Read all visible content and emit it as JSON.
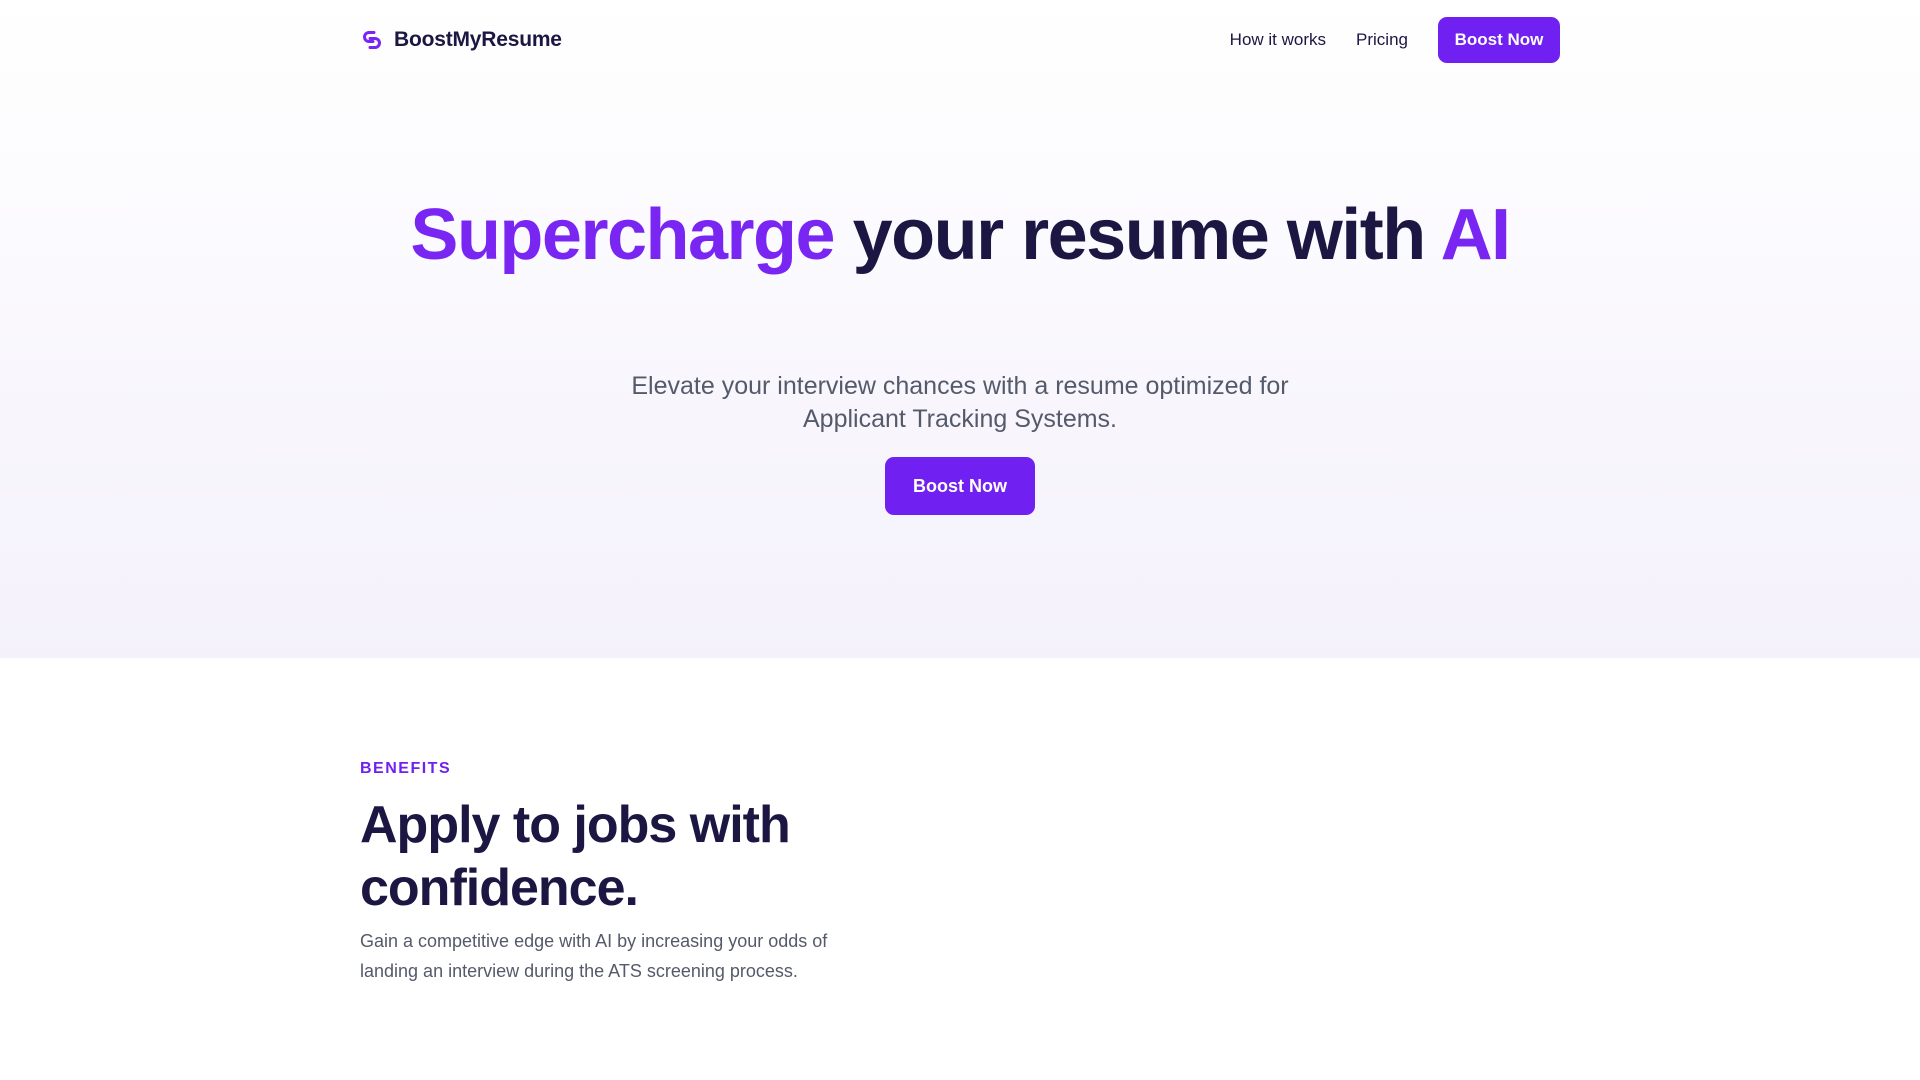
{
  "header": {
    "brand_name": "BoostMyResume",
    "brand_icon": "link-logo-icon",
    "nav": [
      {
        "label": "How it works"
      },
      {
        "label": "Pricing"
      }
    ],
    "cta_label": "Boost Now"
  },
  "hero": {
    "title_accent_1": "Supercharge",
    "title_mid": " your resume with ",
    "title_accent_2": "AI",
    "subtitle": "Elevate your interview chances with a resume optimized for Applicant Tracking Systems.",
    "cta_label": "Boost Now"
  },
  "benefits": {
    "label": "BENEFITS",
    "title": "Apply to jobs with confidence.",
    "text": "Gain a competitive edge with AI by increasing your odds of landing an interview during the ATS screening process."
  },
  "colors": {
    "accent": "#7020f0",
    "heading": "#1b1642",
    "body_text": "#555a6a",
    "hero_bg": "#f4f1fb"
  }
}
